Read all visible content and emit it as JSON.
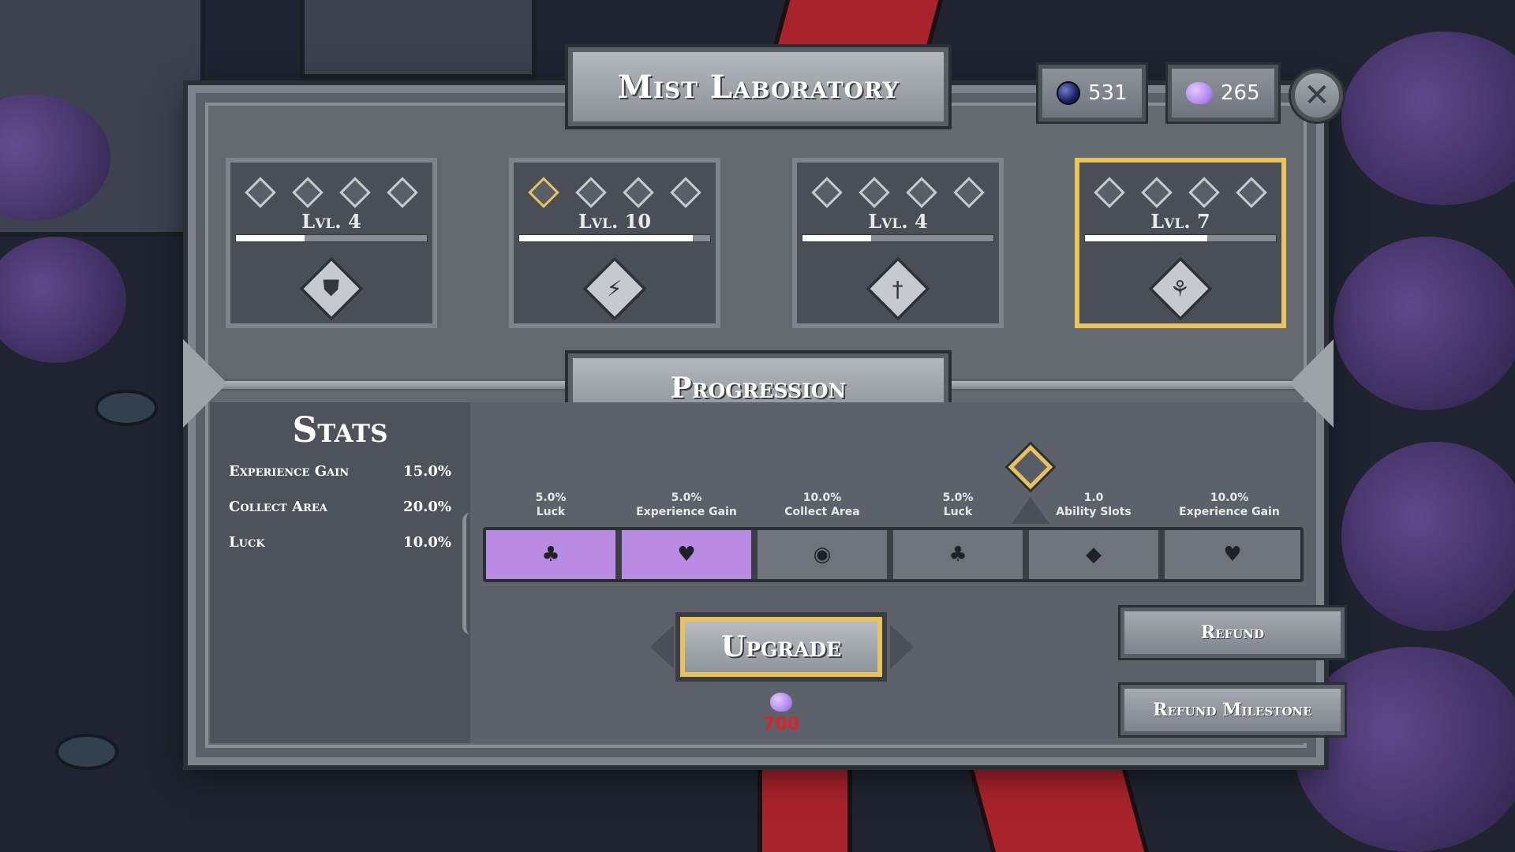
{
  "title": "Mist Laboratory",
  "currency": [
    {
      "icon": "dark-orb-icon",
      "value": "531"
    },
    {
      "icon": "mist-blob-icon",
      "value": "265"
    }
  ],
  "close_icon": "close-icon",
  "cards": [
    {
      "level": "Lvl. 4",
      "progress": 0.36,
      "emblem": "shield-icon",
      "gold_diamonds": 0,
      "selected": false
    },
    {
      "level": "Lvl. 10",
      "progress": 0.91,
      "emblem": "lightning-icon",
      "gold_diamonds": 1,
      "selected": false
    },
    {
      "level": "Lvl. 4",
      "progress": 0.36,
      "emblem": "sword-icon",
      "gold_diamonds": 0,
      "selected": false
    },
    {
      "level": "Lvl. 7",
      "progress": 0.64,
      "emblem": "tree-icon",
      "gold_diamonds": 0,
      "selected": true
    }
  ],
  "progression_title": "Progression",
  "stats": {
    "title": "Stats",
    "rows": [
      {
        "label": "Experience Gain",
        "value": "15.0%"
      },
      {
        "label": "Collect Area",
        "value": "20.0%"
      },
      {
        "label": "Luck",
        "value": "10.0%"
      }
    ]
  },
  "nodes": [
    {
      "value": "5.0%",
      "label": "Luck",
      "icon": "clover-icon",
      "filled": true
    },
    {
      "value": "5.0%",
      "label": "Experience Gain",
      "icon": "heart-gem-icon",
      "filled": true
    },
    {
      "value": "10.0%",
      "label": "Collect Area",
      "icon": "magnet-heart-icon",
      "filled": false
    },
    {
      "value": "5.0%",
      "label": "Luck",
      "icon": "clover-icon",
      "filled": false
    },
    {
      "value": "1.0",
      "label": "Ability Slots",
      "icon": "ability-diamond-icon",
      "filled": false
    },
    {
      "value": "10.0%",
      "label": "Experience Gain",
      "icon": "heart-gem-icon",
      "filled": false
    }
  ],
  "upgrade": {
    "label": "Upgrade",
    "cost": "700",
    "cost_icon": "mist-blob-icon"
  },
  "refund_label": "Refund",
  "refund_milestone_label": "Refund Milestone",
  "colors": {
    "accent_gold": "#e8c25a",
    "node_filled": "#b98be3",
    "cost_red": "#e3202a"
  }
}
